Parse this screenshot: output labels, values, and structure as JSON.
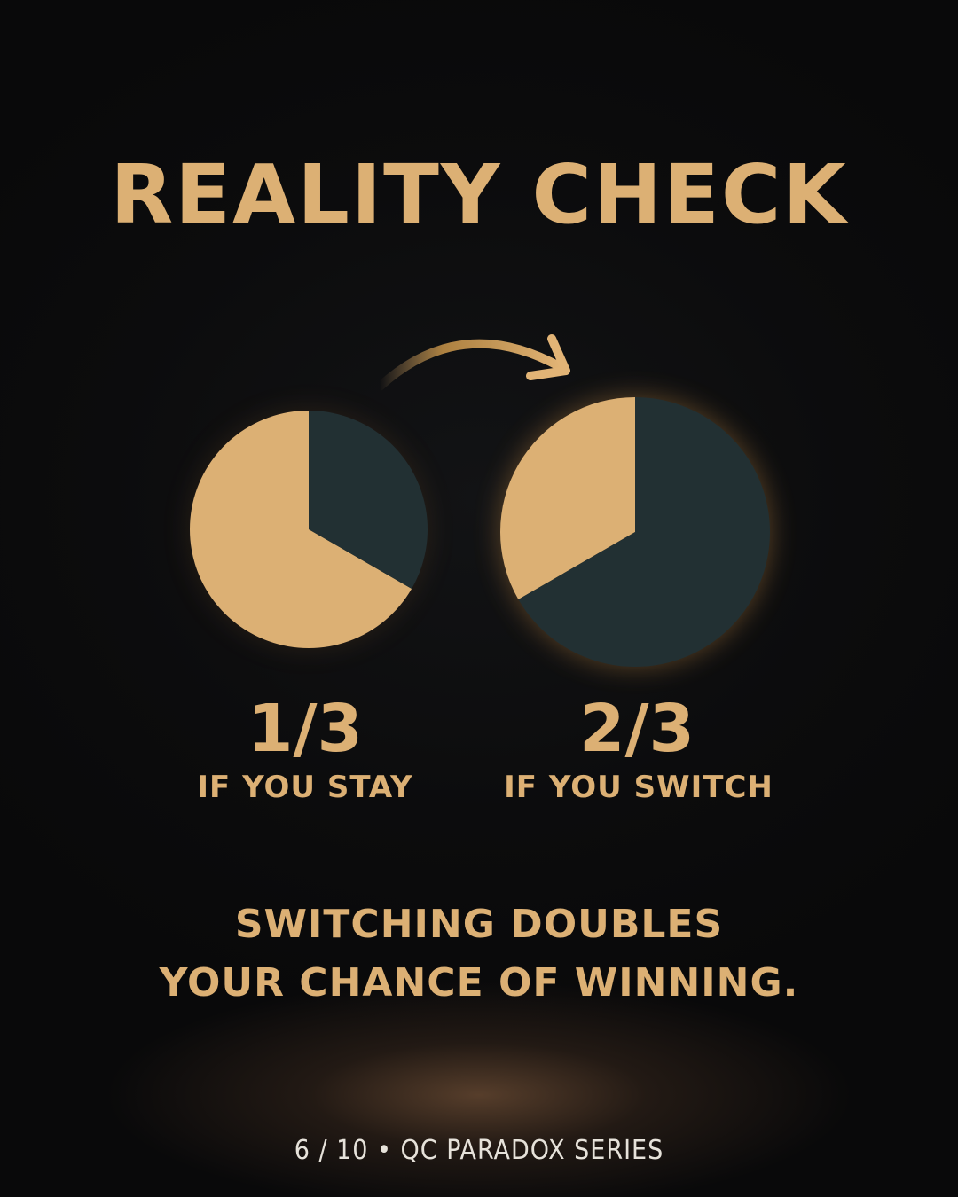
{
  "title": "REALITY CHECK",
  "colors": {
    "background": "#0b0b0c",
    "accent": "#dcb074",
    "dark_slice": "#223033",
    "footer_text": "#e6e2da"
  },
  "chart_data": [
    {
      "type": "pie",
      "title": "",
      "value_label": "1/3",
      "caption": "IF YOU STAY",
      "slices": [
        {
          "name": "",
          "value": 0.6667,
          "color": "#dcb074"
        },
        {
          "name": "",
          "value": 0.3333,
          "color": "#223033"
        }
      ]
    },
    {
      "type": "pie",
      "title": "",
      "value_label": "2/3",
      "caption": "IF YOU SWITCH",
      "slices": [
        {
          "name": "",
          "value": 0.3333,
          "color": "#dcb074"
        },
        {
          "name": "",
          "value": 0.6667,
          "color": "#223033"
        }
      ]
    }
  ],
  "arrow": {
    "icon": "curved-arrow-right-icon"
  },
  "conclusion": {
    "line1": "SWITCHING DOUBLES",
    "line2": "YOUR CHANCE OF WINNING."
  },
  "footer": "6 / 10 • QC PARADOX SERIES"
}
